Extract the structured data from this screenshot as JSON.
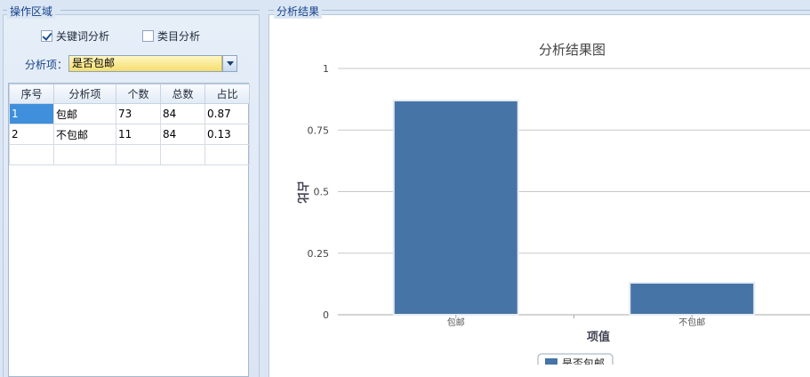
{
  "left_panel": {
    "title": "操作区域",
    "keyword_checkbox": {
      "label": "关键词分析",
      "checked": true
    },
    "category_checkbox": {
      "label": "类目分析",
      "checked": false
    },
    "analysis_item_label": "分析项：",
    "analysis_item_value": "是否包邮",
    "grid": {
      "columns": [
        "序号",
        "分析项",
        "个数",
        "总数",
        "占比"
      ],
      "rows": [
        [
          "1",
          "包邮",
          "73",
          "84",
          "0.87"
        ],
        [
          "2",
          "不包邮",
          "11",
          "84",
          "0.13"
        ]
      ]
    }
  },
  "right_panel": {
    "title": "分析结果"
  },
  "colors": {
    "bar": "#4674a6",
    "panel_title": "#15428b",
    "selected_cell": "#3f8fdc",
    "combo_bg": "#fbee8f"
  },
  "chart_data": {
    "type": "bar",
    "title": "分析结果图",
    "xlabel": "项值",
    "ylabel": "占比",
    "categories": [
      "包邮",
      "不包邮"
    ],
    "series": [
      {
        "name": "是否包邮",
        "values": [
          0.87,
          0.13
        ]
      }
    ],
    "ylim": [
      0,
      1
    ],
    "yticks": [
      "0",
      "0.25",
      "0.5",
      "0.75",
      "1"
    ],
    "grid": true,
    "legend": "bottom-center"
  }
}
